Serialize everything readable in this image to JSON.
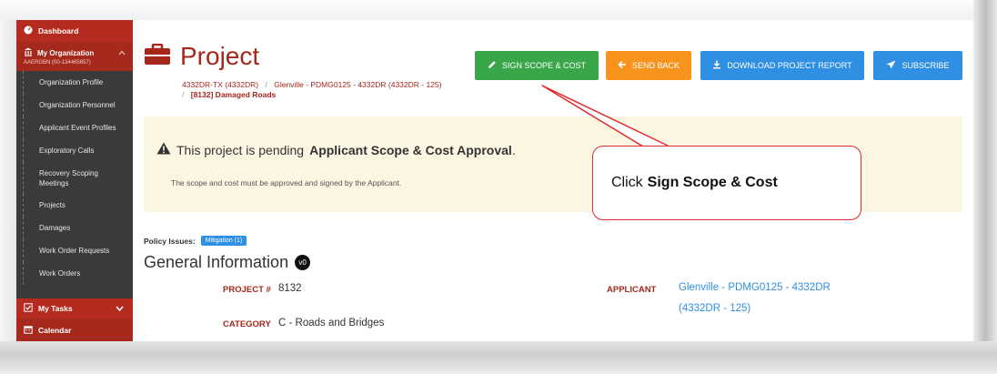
{
  "sidebar": {
    "dashboard": "Dashboard",
    "org_title": "My Organization",
    "org_sub": "AAERGBN (00-134465657)",
    "items": [
      {
        "label": "Organization Profile"
      },
      {
        "label": "Organization Personnel"
      },
      {
        "label": "Applicant Event Profiles"
      },
      {
        "label": "Exploratory Calls"
      },
      {
        "label": "Recovery Scoping Meetings"
      },
      {
        "label": "Projects"
      },
      {
        "label": "Damages"
      },
      {
        "label": "Work Order Requests"
      },
      {
        "label": "Work Orders"
      }
    ],
    "tasks": "My Tasks",
    "calendar": "Calendar"
  },
  "header": {
    "title": "Project",
    "crumb_a": "4332DR-TX (4332DR)",
    "crumb_sep": "/",
    "crumb_b": "Glenville - PDMG0125 - 4332DR (4332DR - 125)",
    "crumb_c": "[8132] Damaged Roads"
  },
  "buttons": {
    "sign": "SIGN SCOPE & COST",
    "back": "SEND BACK",
    "report": "DOWNLOAD PROJECT REPORT",
    "subscribe": "SUBSCRIBE"
  },
  "alert": {
    "prefix": "This project is pending",
    "strong": "Applicant Scope & Cost Approval",
    "suffix": ".",
    "detail": "The scope and cost must be approved and signed by the Applicant."
  },
  "callout": {
    "prefix": "Click",
    "strong": "Sign Scope & Cost"
  },
  "policy": {
    "label": "Policy Issues:",
    "badge": "Mitigation (1)"
  },
  "general": {
    "heading": "General Information",
    "version": "v0",
    "project_label": "PROJECT #",
    "project_value": "8132",
    "category_label": "CATEGORY",
    "category_value": "C - Roads and Bridges",
    "applicant_label": "APPLICANT",
    "applicant_value": "Glenville - PDMG0125 - 4332DR (4332DR - 125)"
  },
  "colors": {
    "brand": "#a5271c",
    "green": "#3aa64a",
    "orange": "#f7941d",
    "blue": "#2f8fe2",
    "alert_bg": "#fbf5e1",
    "callout_border": "#e02b2b"
  }
}
